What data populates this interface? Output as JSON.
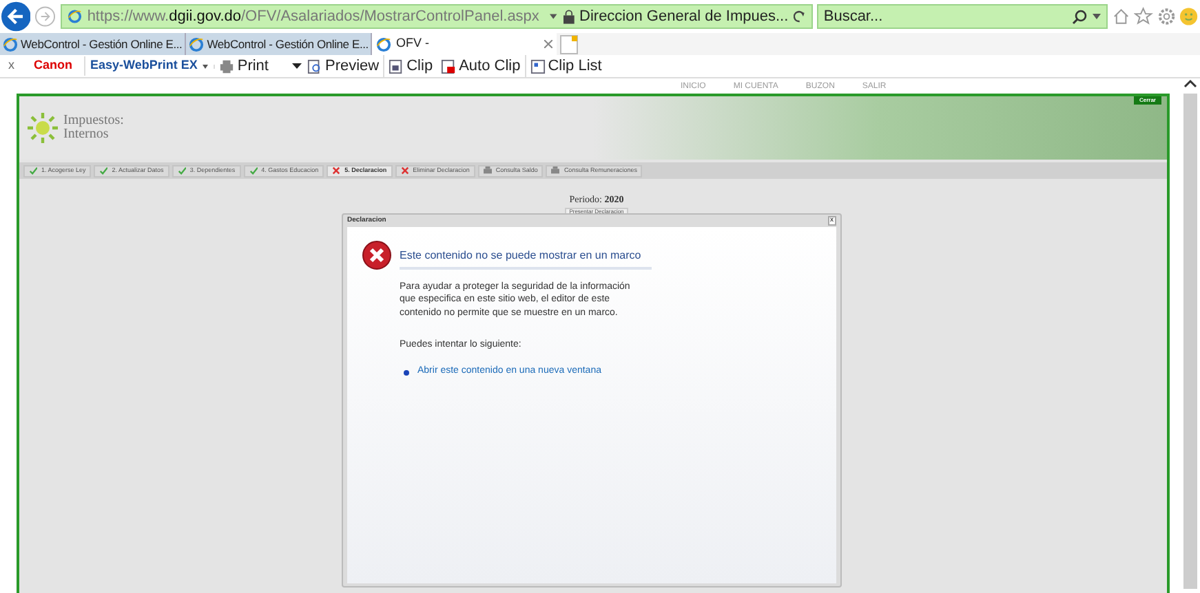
{
  "address_bar": {
    "url_prefix": "https://www.",
    "url_domain": "dgii.gov.do",
    "url_path": "/OFV/Asalariados/MostrarControlPanel.aspx",
    "site_identity": "Direccion General de Impues..."
  },
  "search": {
    "placeholder": "Buscar..."
  },
  "tabs": [
    {
      "label": "WebControl - Gestión Online E...",
      "selected": false
    },
    {
      "label": "WebControl - Gestión Online E...",
      "selected": false
    },
    {
      "label": "OFV -",
      "selected": true
    }
  ],
  "toolbar": {
    "close": "x",
    "brand": "Canon",
    "addon": "Easy-WebPrint EX",
    "buttons": [
      {
        "label": "Print",
        "kind": "print"
      },
      {
        "label": "Preview",
        "kind": "preview"
      },
      {
        "label": "Clip",
        "kind": "clip"
      },
      {
        "label": "Auto Clip",
        "kind": "autoclip"
      },
      {
        "label": "Clip List",
        "kind": "cliplist"
      }
    ]
  },
  "site_menu": [
    "INICIO",
    "MI CUENTA",
    "BUZON",
    "SALIR"
  ],
  "panel": {
    "close_button": "Cerrar",
    "logo_line1": "Impuestos:",
    "logo_line2": "Internos",
    "steps": [
      {
        "label": "1. Acogerse Ley",
        "kind": "done",
        "selected": false
      },
      {
        "label": "2. Actualizar Datos",
        "kind": "done",
        "selected": false
      },
      {
        "label": "3. Dependientes",
        "kind": "done",
        "selected": false
      },
      {
        "label": "4. Gastos Educacion",
        "kind": "done",
        "selected": false
      },
      {
        "label": "5. Declaracion",
        "kind": "error",
        "selected": true
      },
      {
        "label": "Eliminar Declaracion",
        "kind": "error",
        "selected": false
      },
      {
        "label": "Consulta Saldo",
        "kind": "print",
        "selected": false
      },
      {
        "label": "Consulta Remuneraciones",
        "kind": "print",
        "selected": false
      }
    ],
    "period_label": "Periodo:",
    "period_value": "2020",
    "submit_button": "Presentar Declaracion"
  },
  "dialog": {
    "title": "Declaracion",
    "close": "x",
    "heading": "Este contenido no se puede mostrar en un marco",
    "body": "Para ayudar a proteger la seguridad de la información que especifica en este sitio web, el editor de este contenido no permite que se muestre en un marco.",
    "try_label": "Puedes intentar lo siguiente:",
    "link": "Abrir este contenido en una nueva ventana"
  }
}
